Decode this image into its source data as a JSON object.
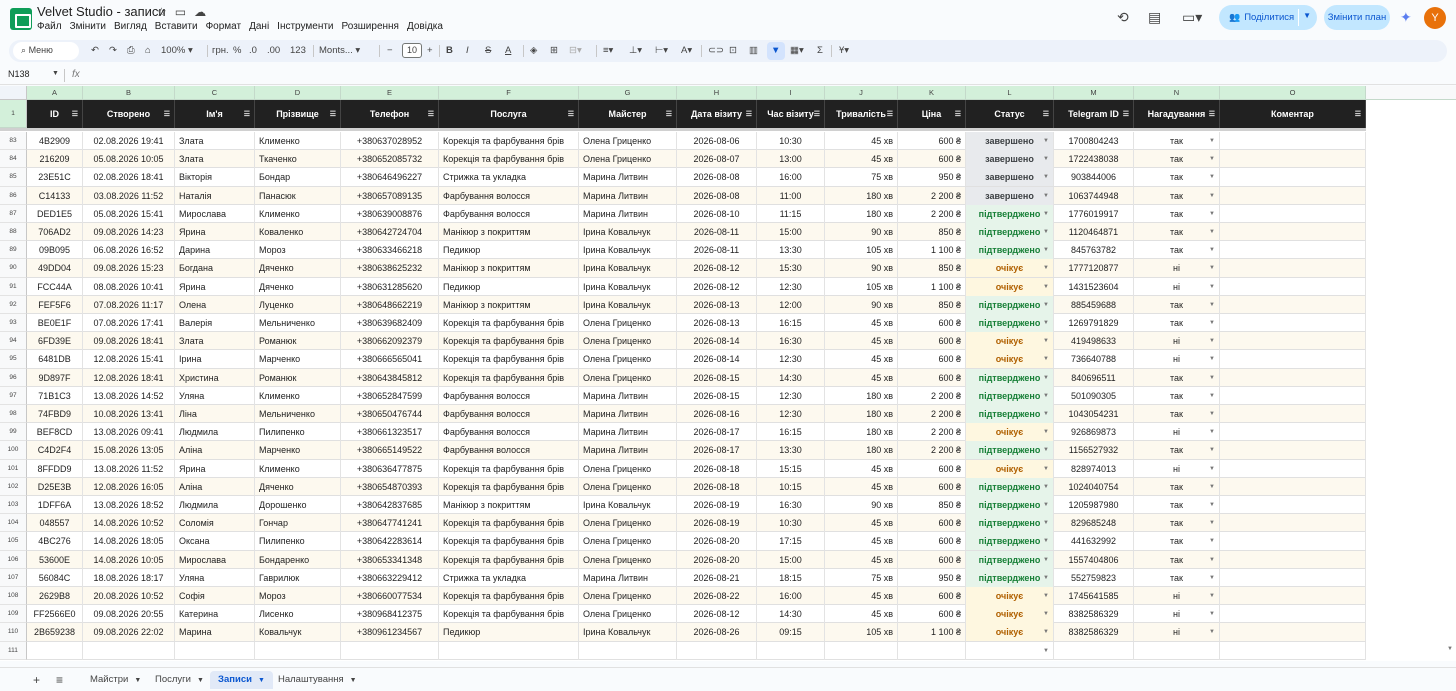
{
  "window": {
    "title": "Velvet Studio - записи",
    "menu": [
      "Файл",
      "Змінити",
      "Вигляд",
      "Вставити",
      "Формат",
      "Дані",
      "Інструменти",
      "Розширення",
      "Довідка"
    ],
    "share_label": "Поділитися",
    "plan_label": "Змінити план",
    "avatar_letter": "Y",
    "accent": "#0b57d0"
  },
  "toolbar": {
    "menu_search": "Меню",
    "zoom": "100%",
    "currency": "грн.",
    "percent": "%",
    "dec_minus": ".0",
    "dec_plus": ".00",
    "number_format": "123",
    "font": "Monts...",
    "font_size": "10"
  },
  "formula": {
    "cell_ref": "N138",
    "fx": "fx"
  },
  "columns": [
    "A",
    "B",
    "C",
    "D",
    "E",
    "F",
    "G",
    "H",
    "I",
    "J",
    "K",
    "L",
    "M",
    "N",
    "O"
  ],
  "headers": [
    "ID",
    "Створено",
    "Ім'я",
    "Прізвище",
    "Телефон",
    "Послуга",
    "Майстер",
    "Дата візиту",
    "Час візиту",
    "Тривалість",
    "Ціна",
    "Статус",
    "Telegram ID",
    "Нагадування",
    "Коментар"
  ],
  "header_row_num": "1",
  "rows": [
    {
      "n": "83",
      "id": "4B2909",
      "created": "02.08.2026 19:41",
      "name": "Злата",
      "surname": "Клименко",
      "phone": "+380637028952",
      "service": "Корекція та фарбування брів",
      "master": "Олена Гриценко",
      "date": "2026-08-06",
      "time": "10:30",
      "dur": "45 хв",
      "price": "600 ₴",
      "status": "завершено",
      "tg": "1700804243",
      "rem": "так"
    },
    {
      "n": "84",
      "id": "216209",
      "created": "05.08.2026 10:05",
      "name": "Злата",
      "surname": "Ткаченко",
      "phone": "+380652085732",
      "service": "Корекція та фарбування брів",
      "master": "Олена Гриценко",
      "date": "2026-08-07",
      "time": "13:00",
      "dur": "45 хв",
      "price": "600 ₴",
      "status": "завершено",
      "tg": "1722438038",
      "rem": "так"
    },
    {
      "n": "85",
      "id": "23E51C",
      "created": "02.08.2026 18:41",
      "name": "Вікторія",
      "surname": "Бондар",
      "phone": "+380646496227",
      "service": "Стрижка та укладка",
      "master": "Марина Литвин",
      "date": "2026-08-08",
      "time": "16:00",
      "dur": "75 хв",
      "price": "950 ₴",
      "status": "завершено",
      "tg": "903844006",
      "rem": "так"
    },
    {
      "n": "86",
      "id": "C14133",
      "created": "03.08.2026 11:52",
      "name": "Наталія",
      "surname": "Панасюк",
      "phone": "+380657089135",
      "service": "Фарбування волосся",
      "master": "Марина Литвин",
      "date": "2026-08-08",
      "time": "11:00",
      "dur": "180 хв",
      "price": "2 200 ₴",
      "status": "завершено",
      "tg": "1063744948",
      "rem": "так"
    },
    {
      "n": "87",
      "id": "DED1E5",
      "created": "05.08.2026 15:41",
      "name": "Мирослава",
      "surname": "Клименко",
      "phone": "+380639008876",
      "service": "Фарбування волосся",
      "master": "Марина Литвин",
      "date": "2026-08-10",
      "time": "11:15",
      "dur": "180 хв",
      "price": "2 200 ₴",
      "status": "підтверджено",
      "tg": "1776019917",
      "rem": "так"
    },
    {
      "n": "88",
      "id": "706AD2",
      "created": "09.08.2026 14:23",
      "name": "Ярина",
      "surname": "Коваленко",
      "phone": "+380642724704",
      "service": "Манікюр з покриттям",
      "master": "Ірина Ковальчук",
      "date": "2026-08-11",
      "time": "15:00",
      "dur": "90 хв",
      "price": "850 ₴",
      "status": "підтверджено",
      "tg": "1120464871",
      "rem": "так"
    },
    {
      "n": "89",
      "id": "09B095",
      "created": "06.08.2026 16:52",
      "name": "Дарина",
      "surname": "Мороз",
      "phone": "+380633466218",
      "service": "Педикюр",
      "master": "Ірина Ковальчук",
      "date": "2026-08-11",
      "time": "13:30",
      "dur": "105 хв",
      "price": "1 100 ₴",
      "status": "підтверджено",
      "tg": "845763782",
      "rem": "так"
    },
    {
      "n": "90",
      "id": "49DD04",
      "created": "09.08.2026 15:23",
      "name": "Богдана",
      "surname": "Дяченко",
      "phone": "+380638625232",
      "service": "Манікюр з покриттям",
      "master": "Ірина Ковальчук",
      "date": "2026-08-12",
      "time": "15:30",
      "dur": "90 хв",
      "price": "850 ₴",
      "status": "очікує",
      "tg": "1777120877",
      "rem": "ні"
    },
    {
      "n": "91",
      "id": "FCC44A",
      "created": "08.08.2026 10:41",
      "name": "Ярина",
      "surname": "Дяченко",
      "phone": "+380631285620",
      "service": "Педикюр",
      "master": "Ірина Ковальчук",
      "date": "2026-08-12",
      "time": "12:30",
      "dur": "105 хв",
      "price": "1 100 ₴",
      "status": "очікує",
      "tg": "1431523604",
      "rem": "ні"
    },
    {
      "n": "92",
      "id": "FEF5F6",
      "created": "07.08.2026 11:17",
      "name": "Олена",
      "surname": "Луценко",
      "phone": "+380648662219",
      "service": "Манікюр з покриттям",
      "master": "Ірина Ковальчук",
      "date": "2026-08-13",
      "time": "12:00",
      "dur": "90 хв",
      "price": "850 ₴",
      "status": "підтверджено",
      "tg": "885459688",
      "rem": "так"
    },
    {
      "n": "93",
      "id": "BE0E1F",
      "created": "07.08.2026 17:41",
      "name": "Валерія",
      "surname": "Мельниченко",
      "phone": "+380639682409",
      "service": "Корекція та фарбування брів",
      "master": "Олена Гриценко",
      "date": "2026-08-13",
      "time": "16:15",
      "dur": "45 хв",
      "price": "600 ₴",
      "status": "підтверджено",
      "tg": "1269791829",
      "rem": "так"
    },
    {
      "n": "94",
      "id": "6FD39E",
      "created": "09.08.2026 18:41",
      "name": "Злата",
      "surname": "Романюк",
      "phone": "+380662092379",
      "service": "Корекція та фарбування брів",
      "master": "Олена Гриценко",
      "date": "2026-08-14",
      "time": "16:30",
      "dur": "45 хв",
      "price": "600 ₴",
      "status": "очікує",
      "tg": "419498633",
      "rem": "ні"
    },
    {
      "n": "95",
      "id": "6481DB",
      "created": "12.08.2026 15:41",
      "name": "Ірина",
      "surname": "Марченко",
      "phone": "+380666565041",
      "service": "Корекція та фарбування брів",
      "master": "Олена Гриценко",
      "date": "2026-08-14",
      "time": "12:30",
      "dur": "45 хв",
      "price": "600 ₴",
      "status": "очікує",
      "tg": "736640788",
      "rem": "ні"
    },
    {
      "n": "96",
      "id": "9D897F",
      "created": "12.08.2026 18:41",
      "name": "Христина",
      "surname": "Романюк",
      "phone": "+380643845812",
      "service": "Корекція та фарбування брів",
      "master": "Олена Гриценко",
      "date": "2026-08-15",
      "time": "14:30",
      "dur": "45 хв",
      "price": "600 ₴",
      "status": "підтверджено",
      "tg": "840696511",
      "rem": "так"
    },
    {
      "n": "97",
      "id": "71B1C3",
      "created": "13.08.2026 14:52",
      "name": "Уляна",
      "surname": "Клименко",
      "phone": "+380652847599",
      "service": "Фарбування волосся",
      "master": "Марина Литвин",
      "date": "2026-08-15",
      "time": "12:30",
      "dur": "180 хв",
      "price": "2 200 ₴",
      "status": "підтверджено",
      "tg": "501090305",
      "rem": "так"
    },
    {
      "n": "98",
      "id": "74FBD9",
      "created": "10.08.2026 13:41",
      "name": "Ліна",
      "surname": "Мельниченко",
      "phone": "+380650476744",
      "service": "Фарбування волосся",
      "master": "Марина Литвин",
      "date": "2026-08-16",
      "time": "12:30",
      "dur": "180 хв",
      "price": "2 200 ₴",
      "status": "підтверджено",
      "tg": "1043054231",
      "rem": "так"
    },
    {
      "n": "99",
      "id": "BEF8CD",
      "created": "13.08.2026 09:41",
      "name": "Людмила",
      "surname": "Пилипенко",
      "phone": "+380661323517",
      "service": "Фарбування волосся",
      "master": "Марина Литвин",
      "date": "2026-08-17",
      "time": "16:15",
      "dur": "180 хв",
      "price": "2 200 ₴",
      "status": "очікує",
      "tg": "926869873",
      "rem": "ні"
    },
    {
      "n": "100",
      "id": "C4D2F4",
      "created": "15.08.2026 13:05",
      "name": "Аліна",
      "surname": "Марченко",
      "phone": "+380665149522",
      "service": "Фарбування волосся",
      "master": "Марина Литвин",
      "date": "2026-08-17",
      "time": "13:30",
      "dur": "180 хв",
      "price": "2 200 ₴",
      "status": "підтверджено",
      "tg": "1156527932",
      "rem": "так"
    },
    {
      "n": "101",
      "id": "8FFDD9",
      "created": "13.08.2026 11:52",
      "name": "Ярина",
      "surname": "Клименко",
      "phone": "+380636477875",
      "service": "Корекція та фарбування брів",
      "master": "Олена Гриценко",
      "date": "2026-08-18",
      "time": "15:15",
      "dur": "45 хв",
      "price": "600 ₴",
      "status": "очікує",
      "tg": "828974013",
      "rem": "ні"
    },
    {
      "n": "102",
      "id": "D25E3B",
      "created": "12.08.2026 16:05",
      "name": "Аліна",
      "surname": "Дяченко",
      "phone": "+380654870393",
      "service": "Корекція та фарбування брів",
      "master": "Олена Гриценко",
      "date": "2026-08-18",
      "time": "10:15",
      "dur": "45 хв",
      "price": "600 ₴",
      "status": "підтверджено",
      "tg": "1024040754",
      "rem": "так"
    },
    {
      "n": "103",
      "id": "1DFF6A",
      "created": "13.08.2026 18:52",
      "name": "Людмила",
      "surname": "Дорошенко",
      "phone": "+380642837685",
      "service": "Манікюр з покриттям",
      "master": "Ірина Ковальчук",
      "date": "2026-08-19",
      "time": "16:30",
      "dur": "90 хв",
      "price": "850 ₴",
      "status": "підтверджено",
      "tg": "1205987980",
      "rem": "так"
    },
    {
      "n": "104",
      "id": "048557",
      "created": "14.08.2026 10:52",
      "name": "Соломія",
      "surname": "Гончар",
      "phone": "+380647741241",
      "service": "Корекція та фарбування брів",
      "master": "Олена Гриценко",
      "date": "2026-08-19",
      "time": "10:30",
      "dur": "45 хв",
      "price": "600 ₴",
      "status": "підтверджено",
      "tg": "829685248",
      "rem": "так"
    },
    {
      "n": "105",
      "id": "4BC276",
      "created": "14.08.2026 18:05",
      "name": "Оксана",
      "surname": "Пилипенко",
      "phone": "+380642283614",
      "service": "Корекція та фарбування брів",
      "master": "Олена Гриценко",
      "date": "2026-08-20",
      "time": "17:15",
      "dur": "45 хв",
      "price": "600 ₴",
      "status": "підтверджено",
      "tg": "441632992",
      "rem": "так"
    },
    {
      "n": "106",
      "id": "53600E",
      "created": "14.08.2026 10:05",
      "name": "Мирослава",
      "surname": "Бондаренко",
      "phone": "+380653341348",
      "service": "Корекція та фарбування брів",
      "master": "Олена Гриценко",
      "date": "2026-08-20",
      "time": "15:00",
      "dur": "45 хв",
      "price": "600 ₴",
      "status": "підтверджено",
      "tg": "1557404806",
      "rem": "так"
    },
    {
      "n": "107",
      "id": "56084C",
      "created": "18.08.2026 18:17",
      "name": "Уляна",
      "surname": "Гаврилюк",
      "phone": "+380663229412",
      "service": "Стрижка та укладка",
      "master": "Марина Литвин",
      "date": "2026-08-21",
      "time": "18:15",
      "dur": "75 хв",
      "price": "950 ₴",
      "status": "підтверджено",
      "tg": "552759823",
      "rem": "так"
    },
    {
      "n": "108",
      "id": "2629B8",
      "created": "20.08.2026 10:52",
      "name": "Софія",
      "surname": "Мороз",
      "phone": "+380660077534",
      "service": "Корекція та фарбування брів",
      "master": "Олена Гриценко",
      "date": "2026-08-22",
      "time": "16:00",
      "dur": "45 хв",
      "price": "600 ₴",
      "status": "очікує",
      "tg": "1745641585",
      "rem": "ні"
    },
    {
      "n": "109",
      "id": "FF2566E0",
      "created": "09.08.2026 20:55",
      "name": "Катерина",
      "surname": "Лисенко",
      "phone": "+380968412375",
      "service": "Корекція та фарбування брів",
      "master": "Олена Гриценко",
      "date": "2026-08-12",
      "time": "14:30",
      "dur": "45 хв",
      "price": "600 ₴",
      "status": "очікує",
      "tg": "8382586329",
      "rem": "ні"
    },
    {
      "n": "110",
      "id": "2B659238",
      "created": "09.08.2026 22:02",
      "name": "Марина",
      "surname": "Ковальчук",
      "phone": "+380961234567",
      "service": "Педикюр",
      "master": "Ірина Ковальчук",
      "date": "2026-08-26",
      "time": "09:15",
      "dur": "105 хв",
      "price": "1 100 ₴",
      "status": "очікує",
      "tg": "8382586329",
      "rem": "ні"
    }
  ],
  "empty_row_num": "111",
  "status_colors": {
    "завершено": "#e8eaed",
    "підтверджено": "#e6f4ea",
    "очікує": "#fef7e0"
  },
  "sheets": [
    {
      "label": "Майстри",
      "active": false
    },
    {
      "label": "Послуги",
      "active": false
    },
    {
      "label": "Записи",
      "active": true
    },
    {
      "label": "Налаштування",
      "active": false
    }
  ]
}
